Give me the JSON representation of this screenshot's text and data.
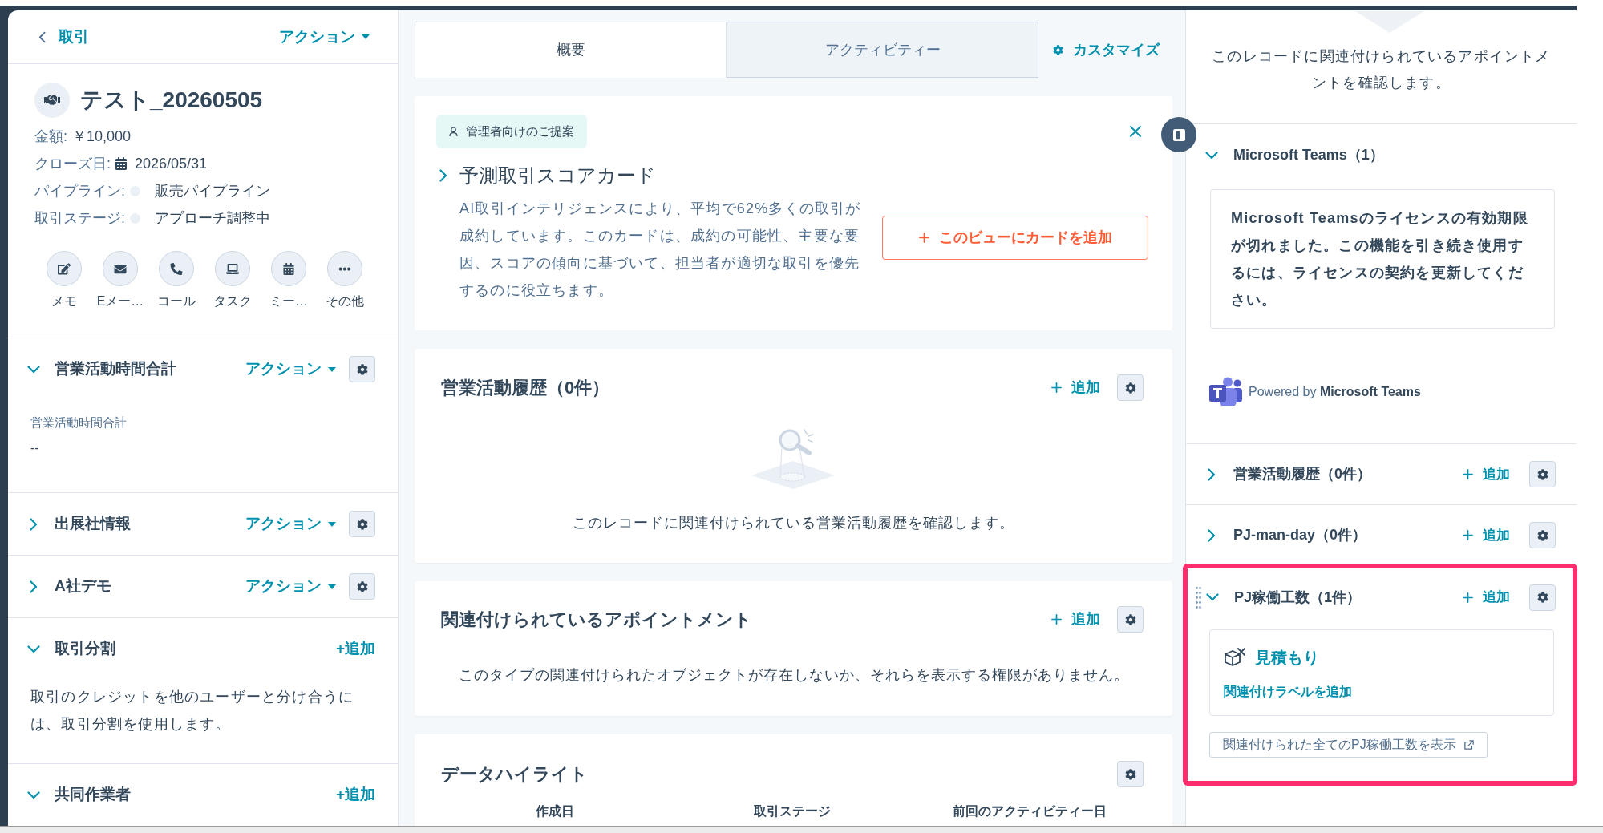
{
  "left_panel": {
    "back_link": "取引",
    "actions_menu": "アクション",
    "record": {
      "title": "テスト_20260505",
      "properties": [
        {
          "kind": "amount",
          "label": "金額:",
          "value": "￥10,000"
        },
        {
          "kind": "date",
          "label": "クローズ日:",
          "value": "2026/05/31"
        },
        {
          "kind": "status",
          "label": "パイプライン:",
          "value": "販売パイプライン"
        },
        {
          "kind": "status",
          "label": "取引ステージ:",
          "value": "アプローチ調整中"
        }
      ]
    },
    "quick_actions": [
      {
        "kind": "note",
        "label": "メモ"
      },
      {
        "kind": "email",
        "label": "Eメー…"
      },
      {
        "kind": "call",
        "label": "コール"
      },
      {
        "kind": "task",
        "label": "タスク"
      },
      {
        "kind": "meeting",
        "label": "ミー…"
      },
      {
        "kind": "more",
        "label": "その他"
      }
    ],
    "sections": [
      {
        "title": "営業活動時間合計",
        "expanded": true,
        "action": {
          "kind": "menu",
          "label": "アクション"
        },
        "settings": true,
        "fields": [
          {
            "label": "営業活動時間合計",
            "value": "--"
          }
        ]
      },
      {
        "title": "出展社情報",
        "expanded": false,
        "action": {
          "kind": "menu",
          "label": "アクション"
        },
        "settings": true
      },
      {
        "title": "A社デモ",
        "expanded": false,
        "action": {
          "kind": "menu",
          "label": "アクション"
        },
        "settings": true
      },
      {
        "title": "取引分割",
        "expanded": true,
        "action": {
          "kind": "add",
          "label": "+追加"
        },
        "settings": false,
        "description": "取引のクレジットを他のユーザーと分け合うには、取引分割を使用します。"
      },
      {
        "title": "共同作業者",
        "expanded": true,
        "action": {
          "kind": "add",
          "label": "+追加"
        },
        "settings": false
      }
    ]
  },
  "main": {
    "tabs": [
      {
        "label": "概要",
        "selected": true
      },
      {
        "label": "アクティビティー",
        "selected": false
      }
    ],
    "customize": "カスタマイズ",
    "suggestion_card": {
      "badge": "管理者向けのご提案",
      "title": "予測取引スコアカード",
      "expanded": false,
      "body": "AI取引インテリジェンスにより、平均で62%多くの取引が成約しています。このカードは、成約の可能性、主要な要因、スコアの傾向に基づいて、担当者が適切な取引を優先するのに役立ちます。",
      "button": "このビューにカードを追加"
    },
    "cards": [
      {
        "kind": "illustrated_empty",
        "title": "営業活動履歴（0件）",
        "add": "追加",
        "settings": true,
        "message": "このレコードに関連付けられている営業活動履歴を確認します。"
      },
      {
        "kind": "empty",
        "title": "関連付けられているアポイントメント",
        "add": "追加",
        "settings": true,
        "message": "このタイプの関連付けられたオブジェクトが存在しないか、それらを表示する権限がありません。"
      },
      {
        "kind": "highlights",
        "title": "データハイライト",
        "settings": true,
        "columns": [
          "作成日",
          "取引ステージ",
          "前回のアクティビティー日"
        ]
      }
    ]
  },
  "right_panel": {
    "intro": "このレコードに関連付けられているアポイントメントを確認します。",
    "sections": [
      {
        "kind": "integration",
        "title": "Microsoft Teams（1）",
        "expanded": true,
        "notice": "Microsoft Teamsのライセンスの有効期限が切れました。この機能を引き続き使用するには、ライセンスの契約を更新してください。",
        "powered_by": "Powered by **Microsoft Teams**"
      },
      {
        "kind": "association",
        "title": "営業活動履歴（0件）",
        "expanded": false,
        "add": "追加",
        "settings": true,
        "highlighted": false,
        "drag_handle": false
      },
      {
        "kind": "association",
        "title": "PJ-man-day（0件）",
        "expanded": false,
        "add": "追加",
        "settings": true,
        "highlighted": false,
        "drag_handle": false
      },
      {
        "kind": "association",
        "title": "PJ稼働工数（1件）",
        "expanded": true,
        "add": "追加",
        "settings": true,
        "highlighted": true,
        "drag_handle": true,
        "records": [
          {
            "name": "見積もり",
            "label_link": "関連付けラベルを追加"
          }
        ],
        "view_all": "関連付けられた全てのPJ稼働工数を表示"
      }
    ]
  }
}
